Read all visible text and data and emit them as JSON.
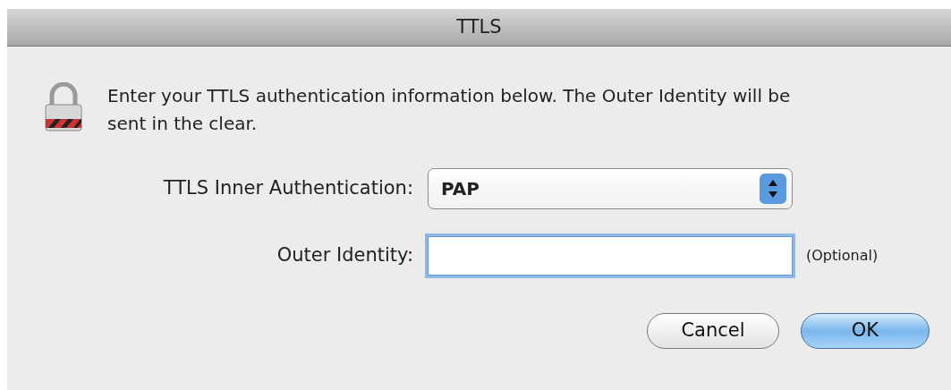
{
  "window": {
    "title": "TTLS"
  },
  "message": "Enter your TTLS authentication information below. The Outer Identity will be sent in the clear.",
  "fields": [
    {
      "kind": "select",
      "label": "TTLS Inner Authentication:",
      "value": "PAP",
      "focused": false
    },
    {
      "kind": "text",
      "label": "Outer Identity:",
      "focused": true,
      "note": "(Optional)"
    }
  ],
  "buttons": [
    {
      "label": "Cancel",
      "default": false
    },
    {
      "label": "OK",
      "default": true
    }
  ]
}
